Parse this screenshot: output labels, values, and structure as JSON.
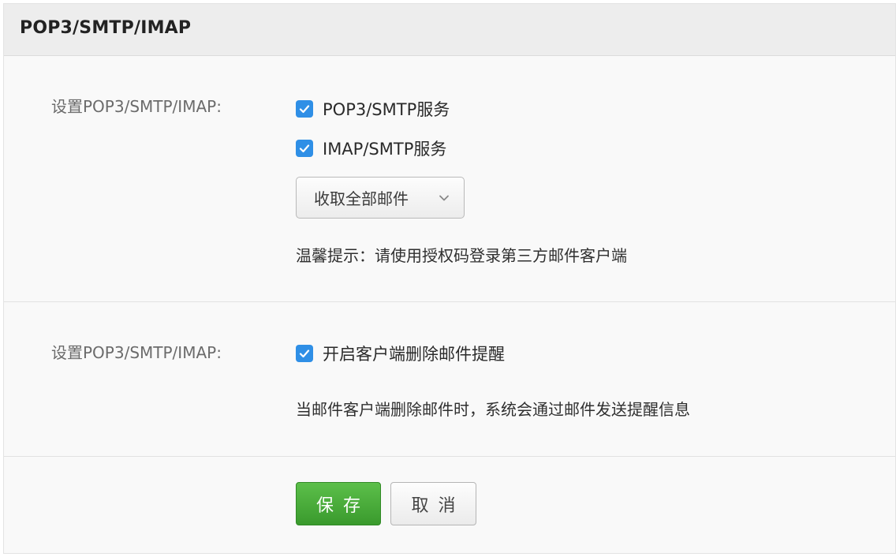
{
  "header": {
    "title": "POP3/SMTP/IMAP"
  },
  "section1": {
    "label": "设置POP3/SMTP/IMAP:",
    "options": [
      {
        "label": "POP3/SMTP服务",
        "checked": true
      },
      {
        "label": "IMAP/SMTP服务",
        "checked": true
      }
    ],
    "select": {
      "value": "收取全部邮件",
      "icon": "chevron-down-icon"
    },
    "hint": "温馨提示：请使用授权码登录第三方邮件客户端"
  },
  "section2": {
    "label": "设置POP3/SMTP/IMAP:",
    "option": {
      "label": "开启客户端删除邮件提醒",
      "checked": true
    },
    "description": "当邮件客户端删除邮件时，系统会通过邮件发送提醒信息"
  },
  "actions": {
    "save_label": "保存",
    "cancel_label": "取消"
  },
  "colors": {
    "checkbox": "#2f8fe6",
    "save_button": "#45a836",
    "header_bg": "#ededed",
    "panel_bg": "#f9f9f9"
  }
}
